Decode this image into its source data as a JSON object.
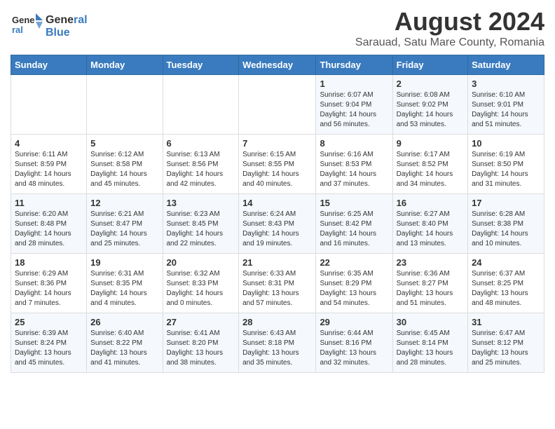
{
  "logo": {
    "line1": "General",
    "line2": "Blue"
  },
  "title": "August 2024",
  "subtitle": "Sarauad, Satu Mare County, Romania",
  "days": [
    "Sunday",
    "Monday",
    "Tuesday",
    "Wednesday",
    "Thursday",
    "Friday",
    "Saturday"
  ],
  "weeks": [
    [
      {
        "date": "",
        "content": ""
      },
      {
        "date": "",
        "content": ""
      },
      {
        "date": "",
        "content": ""
      },
      {
        "date": "",
        "content": ""
      },
      {
        "date": "1",
        "content": "Sunrise: 6:07 AM\nSunset: 9:04 PM\nDaylight: 14 hours and 56 minutes."
      },
      {
        "date": "2",
        "content": "Sunrise: 6:08 AM\nSunset: 9:02 PM\nDaylight: 14 hours and 53 minutes."
      },
      {
        "date": "3",
        "content": "Sunrise: 6:10 AM\nSunset: 9:01 PM\nDaylight: 14 hours and 51 minutes."
      }
    ],
    [
      {
        "date": "4",
        "content": "Sunrise: 6:11 AM\nSunset: 8:59 PM\nDaylight: 14 hours and 48 minutes."
      },
      {
        "date": "5",
        "content": "Sunrise: 6:12 AM\nSunset: 8:58 PM\nDaylight: 14 hours and 45 minutes."
      },
      {
        "date": "6",
        "content": "Sunrise: 6:13 AM\nSunset: 8:56 PM\nDaylight: 14 hours and 42 minutes."
      },
      {
        "date": "7",
        "content": "Sunrise: 6:15 AM\nSunset: 8:55 PM\nDaylight: 14 hours and 40 minutes."
      },
      {
        "date": "8",
        "content": "Sunrise: 6:16 AM\nSunset: 8:53 PM\nDaylight: 14 hours and 37 minutes."
      },
      {
        "date": "9",
        "content": "Sunrise: 6:17 AM\nSunset: 8:52 PM\nDaylight: 14 hours and 34 minutes."
      },
      {
        "date": "10",
        "content": "Sunrise: 6:19 AM\nSunset: 8:50 PM\nDaylight: 14 hours and 31 minutes."
      }
    ],
    [
      {
        "date": "11",
        "content": "Sunrise: 6:20 AM\nSunset: 8:48 PM\nDaylight: 14 hours and 28 minutes."
      },
      {
        "date": "12",
        "content": "Sunrise: 6:21 AM\nSunset: 8:47 PM\nDaylight: 14 hours and 25 minutes."
      },
      {
        "date": "13",
        "content": "Sunrise: 6:23 AM\nSunset: 8:45 PM\nDaylight: 14 hours and 22 minutes."
      },
      {
        "date": "14",
        "content": "Sunrise: 6:24 AM\nSunset: 8:43 PM\nDaylight: 14 hours and 19 minutes."
      },
      {
        "date": "15",
        "content": "Sunrise: 6:25 AM\nSunset: 8:42 PM\nDaylight: 14 hours and 16 minutes."
      },
      {
        "date": "16",
        "content": "Sunrise: 6:27 AM\nSunset: 8:40 PM\nDaylight: 14 hours and 13 minutes."
      },
      {
        "date": "17",
        "content": "Sunrise: 6:28 AM\nSunset: 8:38 PM\nDaylight: 14 hours and 10 minutes."
      }
    ],
    [
      {
        "date": "18",
        "content": "Sunrise: 6:29 AM\nSunset: 8:36 PM\nDaylight: 14 hours and 7 minutes."
      },
      {
        "date": "19",
        "content": "Sunrise: 6:31 AM\nSunset: 8:35 PM\nDaylight: 14 hours and 4 minutes."
      },
      {
        "date": "20",
        "content": "Sunrise: 6:32 AM\nSunset: 8:33 PM\nDaylight: 14 hours and 0 minutes."
      },
      {
        "date": "21",
        "content": "Sunrise: 6:33 AM\nSunset: 8:31 PM\nDaylight: 13 hours and 57 minutes."
      },
      {
        "date": "22",
        "content": "Sunrise: 6:35 AM\nSunset: 8:29 PM\nDaylight: 13 hours and 54 minutes."
      },
      {
        "date": "23",
        "content": "Sunrise: 6:36 AM\nSunset: 8:27 PM\nDaylight: 13 hours and 51 minutes."
      },
      {
        "date": "24",
        "content": "Sunrise: 6:37 AM\nSunset: 8:25 PM\nDaylight: 13 hours and 48 minutes."
      }
    ],
    [
      {
        "date": "25",
        "content": "Sunrise: 6:39 AM\nSunset: 8:24 PM\nDaylight: 13 hours and 45 minutes."
      },
      {
        "date": "26",
        "content": "Sunrise: 6:40 AM\nSunset: 8:22 PM\nDaylight: 13 hours and 41 minutes."
      },
      {
        "date": "27",
        "content": "Sunrise: 6:41 AM\nSunset: 8:20 PM\nDaylight: 13 hours and 38 minutes."
      },
      {
        "date": "28",
        "content": "Sunrise: 6:43 AM\nSunset: 8:18 PM\nDaylight: 13 hours and 35 minutes."
      },
      {
        "date": "29",
        "content": "Sunrise: 6:44 AM\nSunset: 8:16 PM\nDaylight: 13 hours and 32 minutes."
      },
      {
        "date": "30",
        "content": "Sunrise: 6:45 AM\nSunset: 8:14 PM\nDaylight: 13 hours and 28 minutes."
      },
      {
        "date": "31",
        "content": "Sunrise: 6:47 AM\nSunset: 8:12 PM\nDaylight: 13 hours and 25 minutes."
      }
    ]
  ]
}
